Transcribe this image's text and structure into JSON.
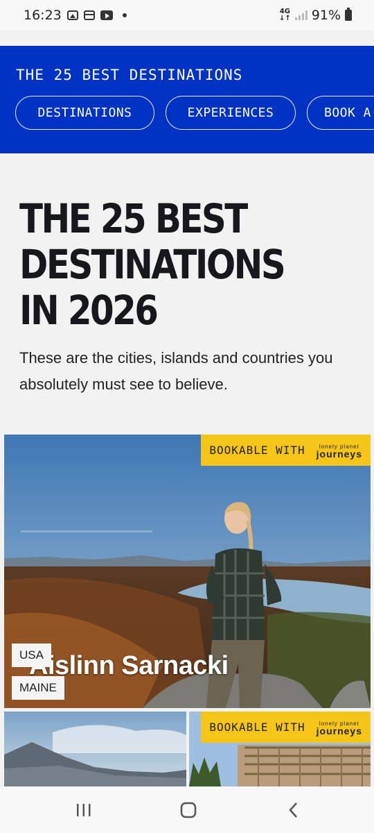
{
  "status_bar": {
    "time": "16:23",
    "network": "4G",
    "battery": "91%"
  },
  "header": {
    "title": "THE 25 BEST DESTINATIONS",
    "nav_pills": [
      "DESTINATIONS",
      "EXPERIENCES",
      "BOOK A TRIP"
    ]
  },
  "hero": {
    "title": "THE 25 BEST DESTINATIONS IN 2026",
    "subtitle": "These are the cities, islands and countries you absolutely must see to believe."
  },
  "card1": {
    "badge": "BOOKABLE WITH",
    "badge_logo_top": "lonely planet",
    "badge_logo_bottom": "journeys",
    "presenter_name": "Aislinn Sarnacki",
    "country": "USA",
    "region": "MAINE"
  },
  "card3": {
    "badge": "BOOKABLE WITH",
    "badge_logo_top": "lonely planet",
    "badge_logo_bottom": "journeys"
  },
  "colors": {
    "brand_blue": "#0033c4",
    "badge_yellow": "#f5c518"
  },
  "icons": [
    "gallery-icon",
    "calendar-icon",
    "youtube-icon",
    "signal-icon",
    "battery-icon",
    "recents-icon",
    "home-icon",
    "back-icon"
  ]
}
